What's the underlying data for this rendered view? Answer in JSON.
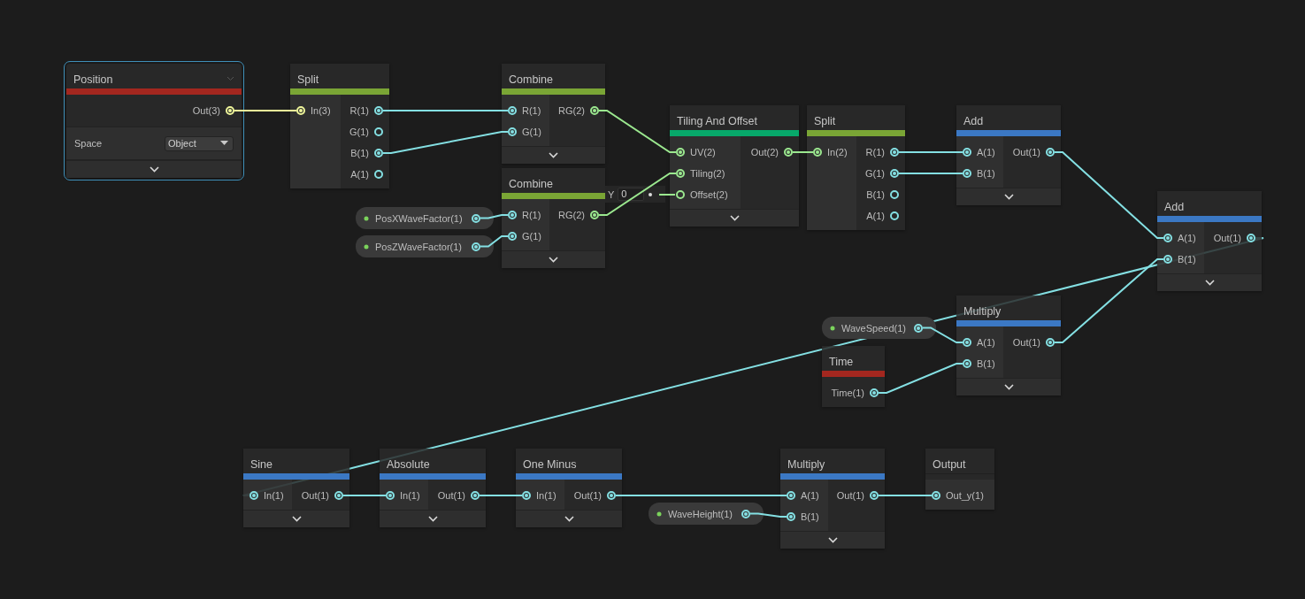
{
  "nodes": [
    {
      "kind": "property_node",
      "title": "Position",
      "color": "#a3271f",
      "selected": true,
      "outputs": [
        {
          "label": "Out(3)",
          "color": "#eef59a"
        }
      ],
      "setting": {
        "label": "Space",
        "value": "Object"
      },
      "collapse_button": true
    },
    {
      "kind": "node",
      "title": "Split",
      "color": "#7aa535",
      "selected": false,
      "inputs": [
        {
          "label": "In(3)",
          "color": "#eef59a"
        }
      ],
      "outputs": [
        {
          "label": "R(1)",
          "color": "#84e0e3"
        },
        {
          "label": "G(1)",
          "color": "#84e0e3"
        },
        {
          "label": "B(1)",
          "color": "#84e0e3"
        },
        {
          "label": "A(1)",
          "color": "#84e0e3"
        }
      ],
      "collapse_button": false
    },
    {
      "kind": "node",
      "title": "Combine",
      "color": "#7aa535",
      "selected": false,
      "inputs": [
        {
          "label": "R(1)",
          "color": "#84e0e3"
        },
        {
          "label": "G(1)",
          "color": "#84e0e3"
        }
      ],
      "outputs": [
        {
          "label": "RG(2)",
          "color": "#9be88f"
        }
      ],
      "collapse_button": true
    },
    {
      "kind": "node",
      "title": "Combine",
      "color": "#7aa535",
      "selected": false,
      "inputs": [
        {
          "label": "R(1)",
          "color": "#84e0e3"
        },
        {
          "label": "G(1)",
          "color": "#84e0e3"
        }
      ],
      "outputs": [
        {
          "label": "RG(2)",
          "color": "#9be88f"
        }
      ],
      "collapse_button": true
    },
    {
      "kind": "property",
      "title": "PosXWaveFactor(1)",
      "selected": false,
      "color": "#84e0e3"
    },
    {
      "kind": "property",
      "title": "PosZWaveFactor(1)",
      "selected": false,
      "color": "#84e0e3"
    },
    {
      "kind": "node",
      "title": "Tiling And Offset",
      "color": "#07a86a",
      "selected": false,
      "inputs": [
        {
          "label": "UV(2)",
          "color": "#9be88f"
        },
        {
          "label": "Tiling(2)",
          "color": "#9be88f"
        },
        {
          "label": "Offset(2)",
          "color": "#9be88f",
          "inline": {
            "label": "Y",
            "value": "0"
          }
        }
      ],
      "outputs": [
        {
          "label": "Out(2)",
          "color": "#9be88f"
        }
      ],
      "collapse_button": true
    },
    {
      "kind": "node",
      "title": "Split",
      "color": "#7aa535",
      "selected": false,
      "inputs": [
        {
          "label": "In(2)",
          "color": "#9be88f"
        }
      ],
      "outputs": [
        {
          "label": "R(1)",
          "color": "#84e0e3"
        },
        {
          "label": "G(1)",
          "color": "#84e0e3"
        },
        {
          "label": "B(1)",
          "color": "#84e0e3"
        },
        {
          "label": "A(1)",
          "color": "#84e0e3"
        }
      ],
      "collapse_button": false
    },
    {
      "kind": "node",
      "title": "Add",
      "color": "#3b78c4",
      "selected": false,
      "inputs": [
        {
          "label": "A(1)",
          "color": "#84e0e3"
        },
        {
          "label": "B(1)",
          "color": "#84e0e3"
        }
      ],
      "outputs": [
        {
          "label": "Out(1)",
          "color": "#84e0e3"
        }
      ],
      "collapse_button": true
    },
    {
      "kind": "node",
      "title": "Add",
      "color": "#3b78c4",
      "selected": false,
      "inputs": [
        {
          "label": "A(1)",
          "color": "#84e0e3"
        },
        {
          "label": "B(1)",
          "color": "#84e0e3"
        }
      ],
      "outputs": [
        {
          "label": "Out(1)",
          "color": "#84e0e3"
        }
      ],
      "collapse_button": true
    },
    {
      "kind": "property",
      "title": "WaveSpeed(1)",
      "selected": false,
      "color": "#84e0e3"
    },
    {
      "kind": "node",
      "title": "Multiply",
      "color": "#3b78c4",
      "selected": false,
      "inputs": [
        {
          "label": "A(1)",
          "color": "#84e0e3"
        },
        {
          "label": "B(1)",
          "color": "#84e0e3"
        }
      ],
      "outputs": [
        {
          "label": "Out(1)",
          "color": "#84e0e3"
        }
      ],
      "collapse_button": true
    },
    {
      "kind": "node",
      "title": "Time",
      "color": "#a3271f",
      "selected": false,
      "outputs": [
        {
          "label": "Time(1)",
          "color": "#84e0e3"
        }
      ],
      "collapse_button": false
    },
    {
      "kind": "node",
      "title": "Sine",
      "color": "#3b78c4",
      "selected": false,
      "inputs": [
        {
          "label": "In(1)",
          "color": "#84e0e3"
        }
      ],
      "outputs": [
        {
          "label": "Out(1)",
          "color": "#84e0e3"
        }
      ],
      "collapse_button": true
    },
    {
      "kind": "node",
      "title": "Absolute",
      "color": "#3b78c4",
      "selected": false,
      "inputs": [
        {
          "label": "In(1)",
          "color": "#84e0e3"
        }
      ],
      "outputs": [
        {
          "label": "Out(1)",
          "color": "#84e0e3"
        }
      ],
      "collapse_button": true
    },
    {
      "kind": "node",
      "title": "One Minus",
      "color": "#3b78c4",
      "selected": false,
      "inputs": [
        {
          "label": "In(1)",
          "color": "#84e0e3"
        }
      ],
      "outputs": [
        {
          "label": "Out(1)",
          "color": "#84e0e3"
        }
      ],
      "collapse_button": true
    },
    {
      "kind": "property",
      "title": "WaveHeight(1)",
      "selected": false,
      "color": "#84e0e3"
    },
    {
      "kind": "node",
      "title": "Multiply",
      "color": "#3b78c4",
      "selected": false,
      "inputs": [
        {
          "label": "A(1)",
          "color": "#84e0e3"
        },
        {
          "label": "B(1)",
          "color": "#84e0e3"
        }
      ],
      "outputs": [
        {
          "label": "Out(1)",
          "color": "#84e0e3"
        }
      ],
      "collapse_button": true
    },
    {
      "kind": "node",
      "title": "Output",
      "selected": false,
      "inputs": [
        {
          "label": "Out_y(1)",
          "color": "#84e0e3"
        }
      ],
      "collapse_button": false
    }
  ]
}
